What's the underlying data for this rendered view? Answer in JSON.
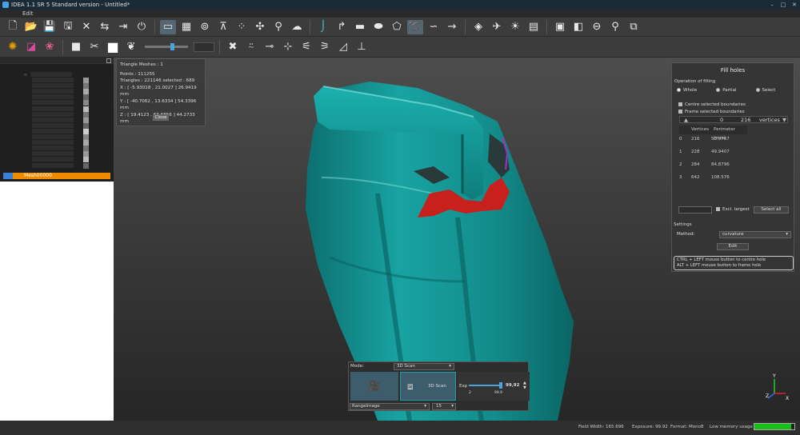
{
  "window": {
    "title": "IDEA 1.1 SR 5 Standard version - Untitled*"
  },
  "menu": {
    "items": [
      "Edit"
    ]
  },
  "tree": {
    "selected_mesh": "Mesh00000"
  },
  "info_panel": {
    "header": "Triangle Meshes :    1",
    "points": "Points :       111255",
    "triangles": "Triangles :    221146   selected :   689",
    "x": "X :  [ -5.93018 , 21.0027 ]   26.9419 mm",
    "y": "Y :  [ -40.7062 , 13.6334 ]  54.3396 mm",
    "z": "Z :  [ 19.4123 , 63.6856 ]   44.2733 mm",
    "close": "Close"
  },
  "fill_holes": {
    "title": "Fill holes",
    "operation_label": "Operation of filling",
    "options": [
      "Whole",
      "Partial",
      "Select"
    ],
    "centre_selected": "Centre selected boundaries",
    "frame_selected": "Frame selected boundaries",
    "stepper_up": "▲",
    "stepper_value": "0",
    "stepper_max": "216",
    "stepper_unit": "vertices",
    "stepper_down": "▼",
    "col_vertices": "Vertices",
    "col_perimeter": "Perimeter (mm)",
    "rows": [
      {
        "id": "0",
        "vertices": "216",
        "perimeter": "50.9767"
      },
      {
        "id": "1",
        "vertices": "228",
        "perimeter": "49.9407"
      },
      {
        "id": "2",
        "vertices": "284",
        "perimeter": "84.8796"
      },
      {
        "id": "3",
        "vertices": "642",
        "perimeter": "108.576"
      }
    ],
    "excl_largest": "Excl. largest",
    "select_all": "Select all",
    "settings_label": "Settings",
    "method_label": "Method:",
    "method_value": "curvature",
    "fill_button": "Edit",
    "hint1": "CTRL + LEFT mouse button to centre hole",
    "hint2": "ALT + LEFT mouse button to frame hole"
  },
  "scan_panel": {
    "mode_label": "Mode:",
    "mode_value": "3D Scan",
    "scan_button": "3D Scan",
    "exp_label": "Exp",
    "exp_value": "99,92",
    "exp_min": "2",
    "exp_max": "99.9",
    "exposure_fraction": 0.95,
    "source": "RangeImage",
    "fps": "15"
  },
  "status": {
    "field_width": "Field Width: 165.696",
    "exposure": "Exposure: 99.92",
    "format": "Format: Mono8",
    "memory": "Low memory usage"
  },
  "axis": {
    "y": "Y",
    "z": "Z",
    "x": "X"
  },
  "colors": {
    "mesh": "#14908f",
    "selection": "#c8201c",
    "tree_selected": "#f08a00",
    "memory_bar": "#16c016"
  }
}
